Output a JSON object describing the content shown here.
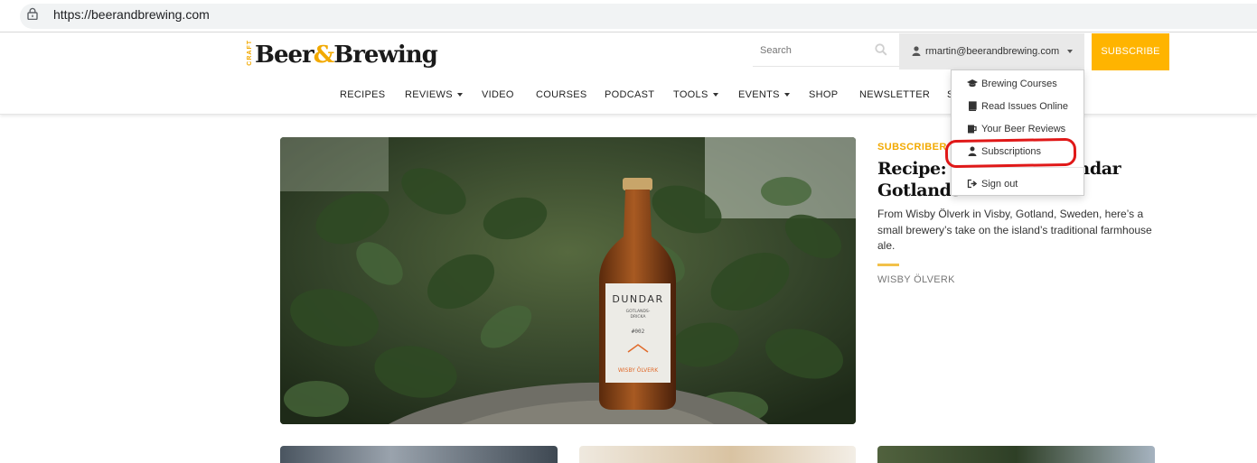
{
  "browser": {
    "url": "https://beerandbrewing.com"
  },
  "header": {
    "logo": {
      "craft": "CRAFT",
      "word1": "Beer",
      "amp": "&",
      "word2": "Brewing"
    },
    "search_placeholder": "Search",
    "user_email": "rmartin@beerandbrewing.com",
    "subscribe_label": "SUBSCRIBE"
  },
  "nav": {
    "items": [
      {
        "label": "RECIPES",
        "has_caret": false
      },
      {
        "label": "REVIEWS",
        "has_caret": true
      },
      {
        "label": "VIDEO",
        "has_caret": false
      },
      {
        "label": "COURSES",
        "has_caret": false
      },
      {
        "label": "PODCAST",
        "has_caret": false
      },
      {
        "label": "TOOLS",
        "has_caret": true
      },
      {
        "label": "EVENTS",
        "has_caret": true
      },
      {
        "label": "SHOP",
        "has_caret": false
      },
      {
        "label": "NEWSLETTER",
        "has_caret": false
      },
      {
        "label": "S",
        "has_caret": false
      }
    ]
  },
  "dropdown": {
    "items": [
      {
        "label": "Brewing Courses",
        "icon": "graduation-cap-icon"
      },
      {
        "label": "Read Issues Online",
        "icon": "book-icon"
      },
      {
        "label": "Your Beer Reviews",
        "icon": "beer-icon"
      },
      {
        "label": "Subscriptions",
        "icon": "user-icon",
        "highlighted": true
      },
      {
        "label": "Sign out",
        "icon": "sign-out-icon"
      }
    ]
  },
  "feature": {
    "kicker": "SUBSCRIBER",
    "headline_line1": "Recipe: W",
    "headline_line1_end": "ndar",
    "headline_line2": "Gotlands",
    "dek": "From Wisby Ölverk in Visby, Gotland, Sweden, here’s a small brewery’s take on the island’s traditional farmhouse ale.",
    "byline": "WISBY ÖLVERK",
    "bottle_label": {
      "brand": "DUNDAR",
      "sub1": "GOTLANDS-",
      "sub2": "DRICKA",
      "number": "#002",
      "maker": "WISBY ÖLVERK"
    }
  },
  "colors": {
    "accent": "#ffb400",
    "kicker": "#f2a900",
    "highlight_ring": "#e01818"
  }
}
